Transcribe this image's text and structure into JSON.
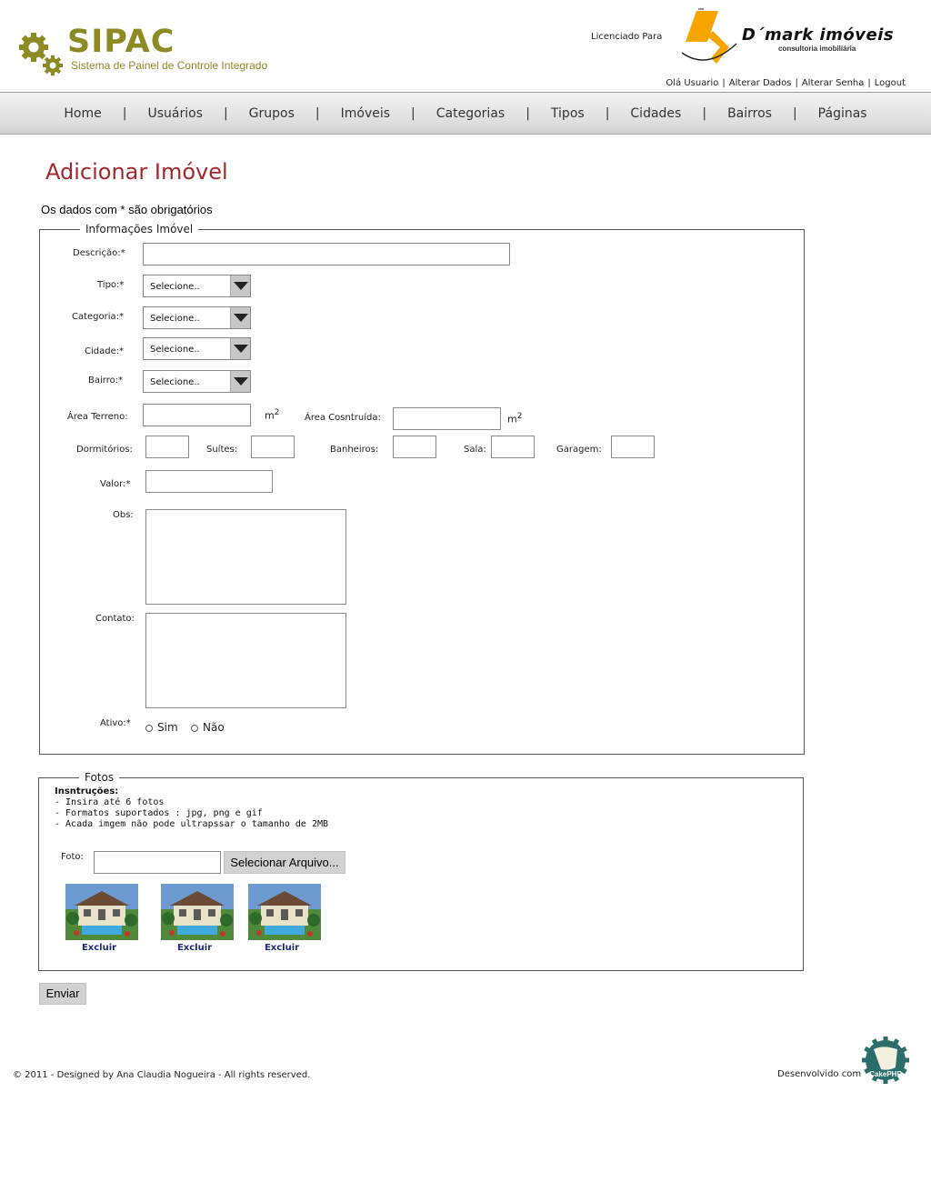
{
  "header": {
    "brand_title": "SIPAC",
    "brand_subtitle": "Sistema de Painel de Controle Integrado",
    "license_label": "Licenciado Para",
    "client_name": "D´mark imóveis",
    "client_tagline": "consultoria imobiliária",
    "user_links": [
      "Olá Usuario",
      "Alterar Dados",
      "Alterar Senha",
      "Logout"
    ],
    "user_link_separator": "|"
  },
  "nav": {
    "items": [
      "Home",
      "Usuários",
      "Grupos",
      "Imóveis",
      "Categorias",
      "Tipos",
      "Cidades",
      "Bairros",
      "Páginas"
    ],
    "separator": "|"
  },
  "main": {
    "title": "Adicionar Imóvel",
    "required_note": "Os dados com * são obrigatórios"
  },
  "info_section": {
    "legend": "Informações Imóvel",
    "labels": {
      "descricao": "Descrição:*",
      "tipo": "Tipo:*",
      "categoria": "Categoria:*",
      "cidade": "Cidade:*",
      "bairro": "Bairro:*",
      "area_terreno": "Área Terreno:",
      "area_construida": "Área Cosntruída:",
      "dormitorios": "Dormitórios:",
      "suites": "Suítes:",
      "banheiros": "Banheiros:",
      "sala": "Sala:",
      "garagem": "Garagem:",
      "valor": "Valor:*",
      "obs": "Obs:",
      "contato": "Contato:",
      "ativo": "Ativo:*"
    },
    "select_placeholder": "Selecione..",
    "unit": "m",
    "unit_exp": "2",
    "radio_options": [
      "Sim",
      "Não"
    ]
  },
  "photos_section": {
    "legend": "Fotos",
    "instructions_title": "Insntruções:",
    "instructions": [
      "- Insira até 6 fotos",
      "- Formatos suportados : jpg, png e gif",
      "- Acada imgem não pode ultrapssar o tamanho de 2MB"
    ],
    "foto_label": "Foto:",
    "file_button": "Selecionar Arquivo...",
    "delete_label": "Excluir"
  },
  "form": {
    "submit": "Enviar"
  },
  "footer": {
    "copyright": "© 2011 - Designed by Ana Claudia Nogueira - All rights reserved.",
    "developed_with": "Desenvolvido com",
    "cake_text": "CakePHP"
  },
  "colors": {
    "brand_olive": "#8d8a24",
    "title_red": "#a3282c",
    "client_orange": "#f5a400",
    "link_navy": "#1a2b7a"
  }
}
